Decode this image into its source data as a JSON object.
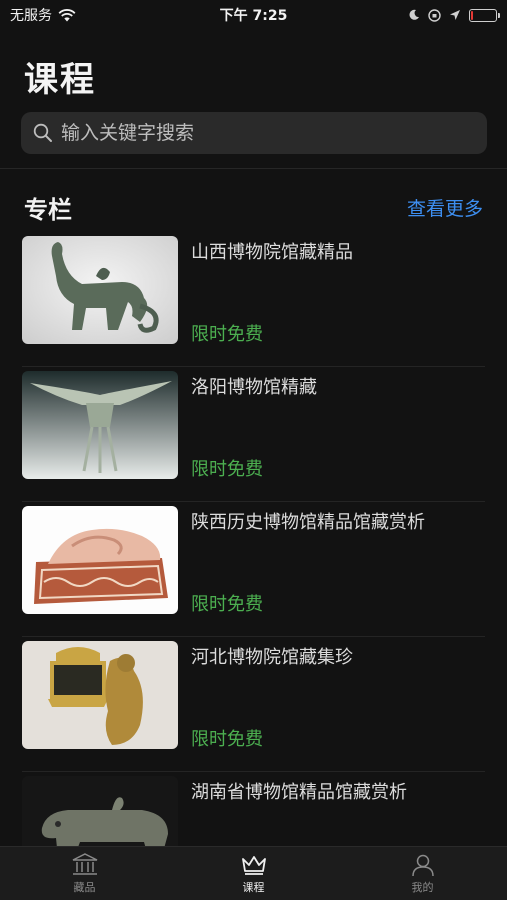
{
  "status_bar": {
    "carrier": "无服务",
    "time": "下午 7:25",
    "battery_level": 0.1,
    "battery_color": "#e53935"
  },
  "header": {
    "title": "课程"
  },
  "search": {
    "placeholder": "输入关键字搜索"
  },
  "section": {
    "title": "专栏",
    "more_label": "查看更多",
    "more_color": "#3d8ef0"
  },
  "courses": [
    {
      "title": "山西博物院馆藏精品",
      "tag": "限时免费"
    },
    {
      "title": "洛阳博物馆精藏",
      "tag": "限时免费"
    },
    {
      "title": "陕西历史博物馆精品馆藏赏析",
      "tag": "限时免费"
    },
    {
      "title": "河北博物院馆藏集珍",
      "tag": "限时免费"
    },
    {
      "title": "湖南省博物馆精品馆藏赏析",
      "tag": ""
    }
  ],
  "tab_bar": {
    "tabs": [
      {
        "label": "藏品",
        "icon": "museum-icon",
        "active": false
      },
      {
        "label": "课程",
        "icon": "crown-icon",
        "active": true
      },
      {
        "label": "我的",
        "icon": "user-icon",
        "active": false
      }
    ]
  },
  "colors": {
    "free_tag": "#4caf50",
    "background": "#121212"
  }
}
